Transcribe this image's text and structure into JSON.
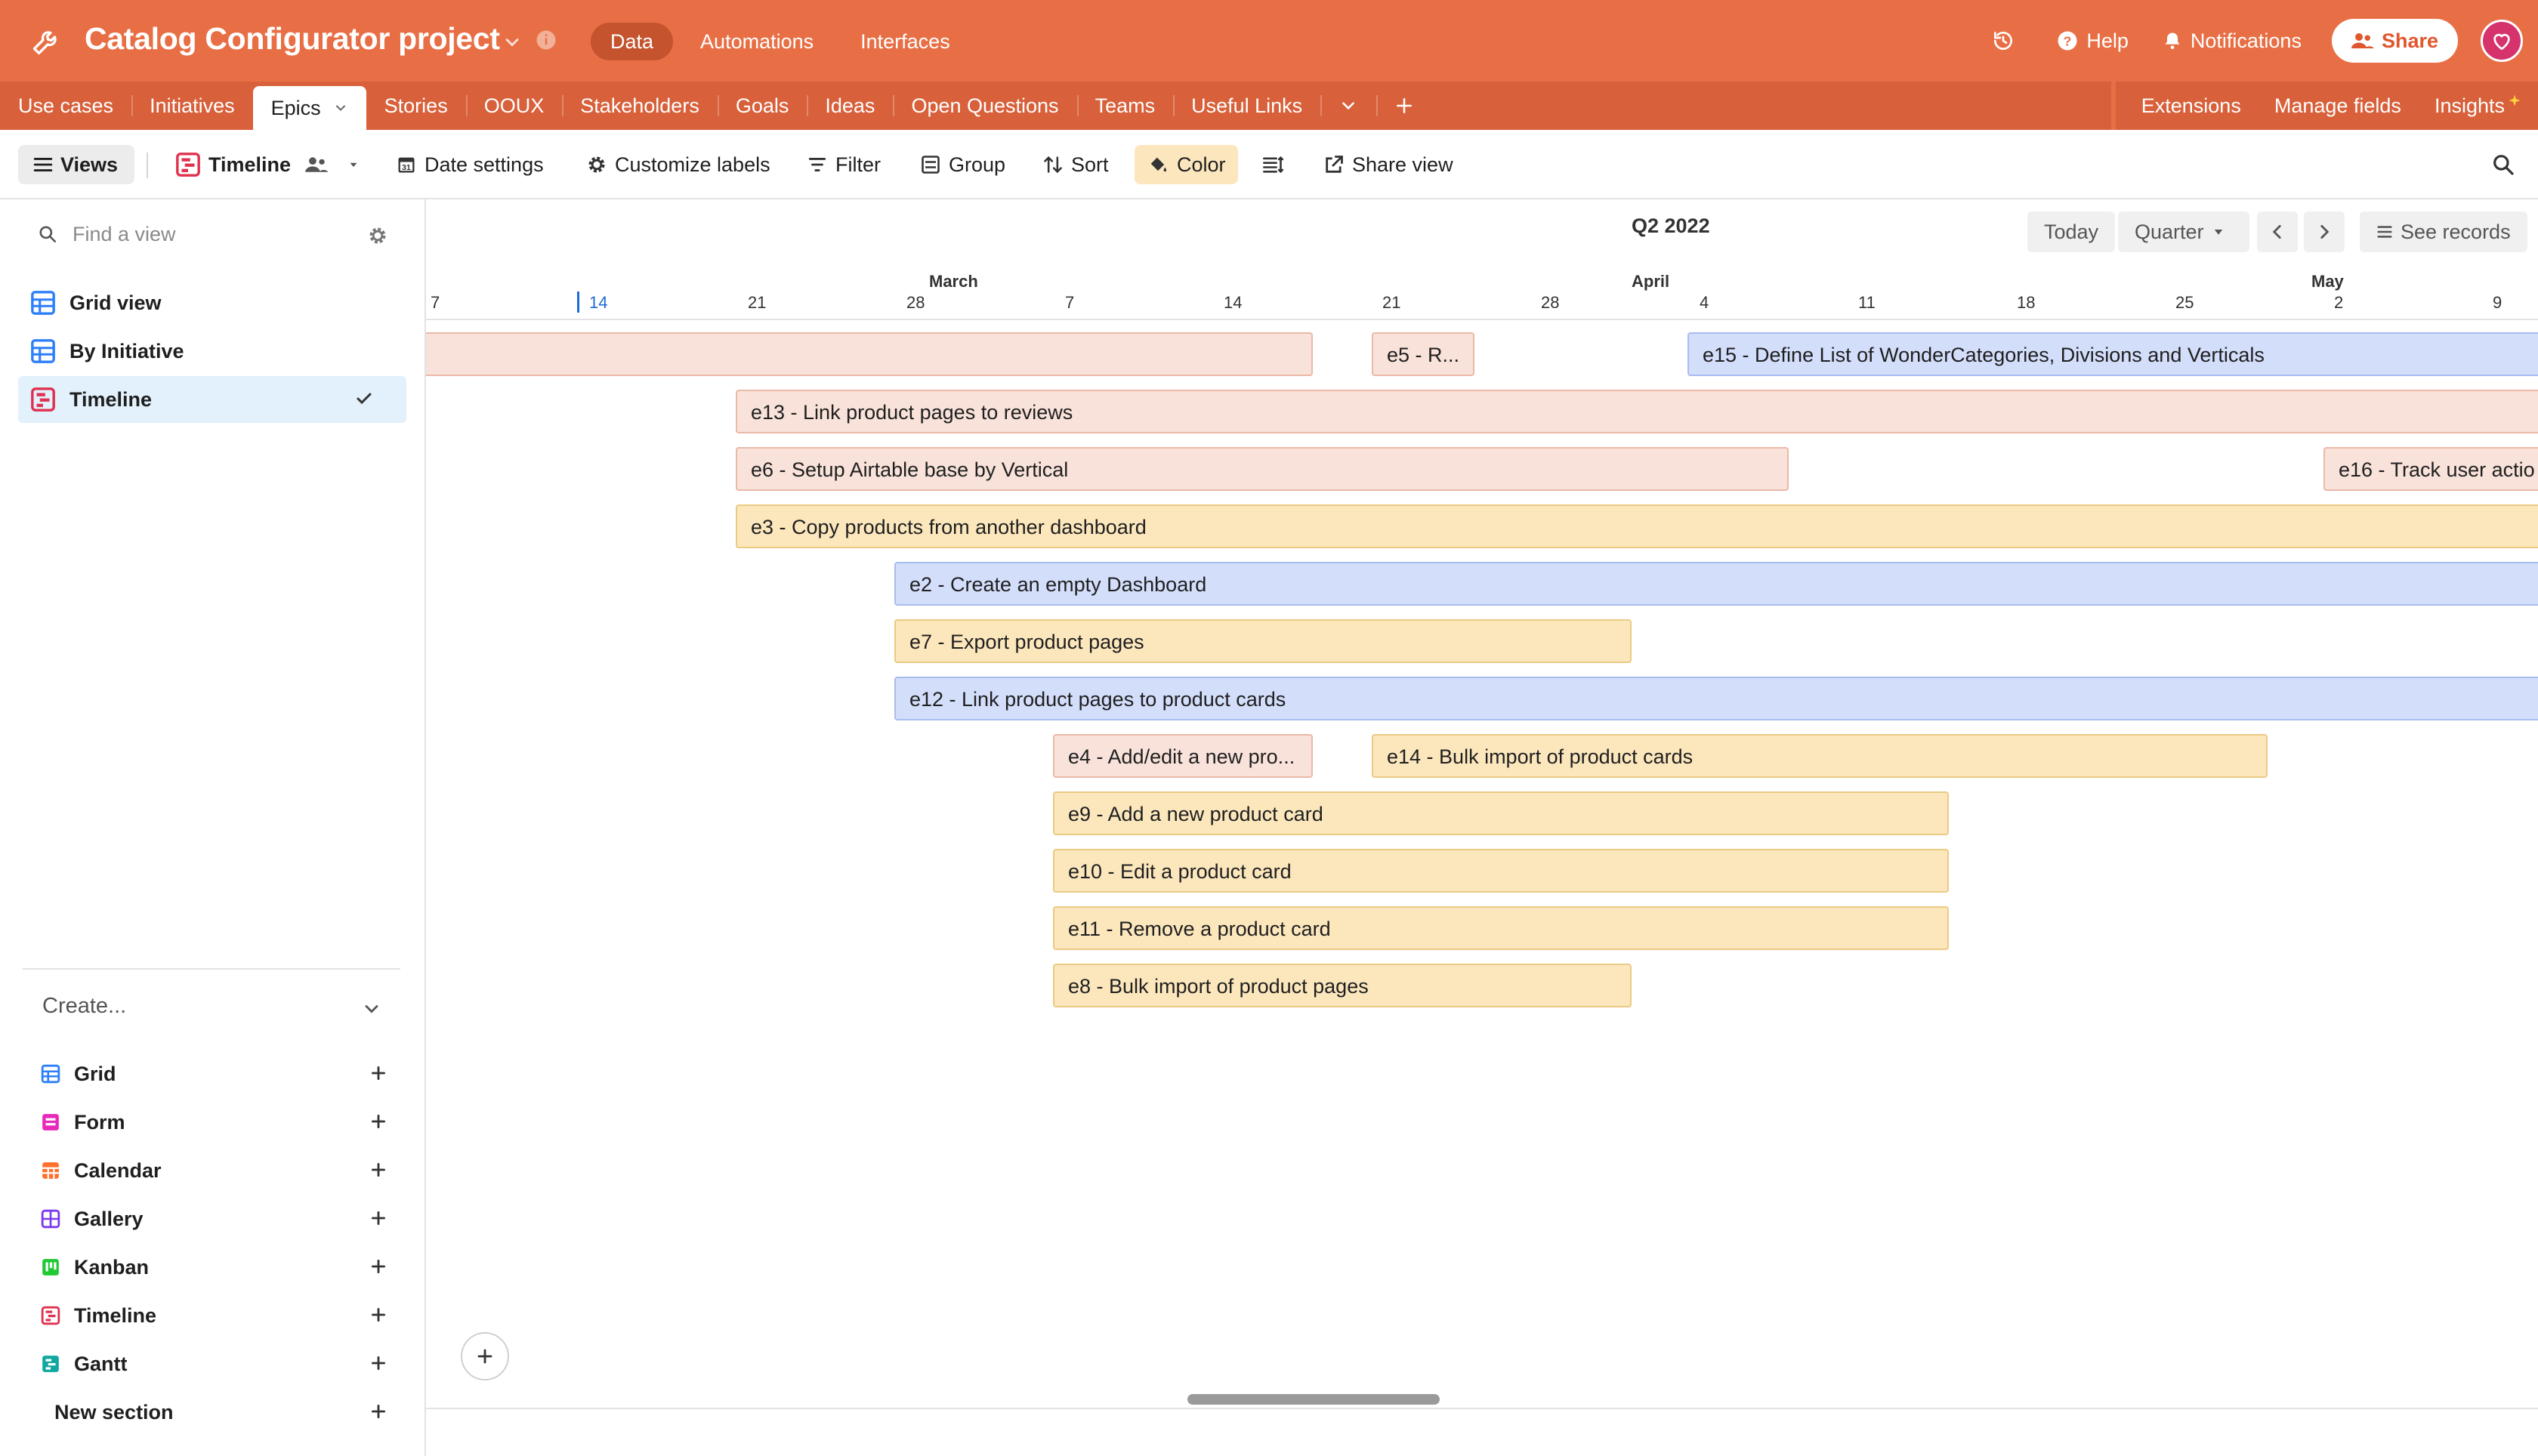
{
  "app": {
    "title": "Catalog Configurator project",
    "nav": [
      "Data",
      "Automations",
      "Interfaces"
    ],
    "help": "Help",
    "notifications": "Notifications",
    "share": "Share",
    "accent": "#e86f45"
  },
  "tables": {
    "tabs": [
      "Use cases",
      "Initiatives",
      "Epics",
      "Stories",
      "OOUX",
      "Stakeholders",
      "Goals",
      "Ideas",
      "Open Questions",
      "Teams",
      "Useful Links"
    ],
    "active": "Epics",
    "right": [
      "Extensions",
      "Manage fields",
      "Insights"
    ]
  },
  "toolbar": {
    "views": "Views",
    "view_name": "Timeline",
    "date_settings": "Date settings",
    "customize_labels": "Customize labels",
    "filter": "Filter",
    "group": "Group",
    "sort": "Sort",
    "color": "Color",
    "share_view": "Share view"
  },
  "sidebar": {
    "find_placeholder": "Find a view",
    "views": [
      {
        "label": "Grid view",
        "icon": "grid-icon"
      },
      {
        "label": "By Initiative",
        "icon": "grid-icon"
      },
      {
        "label": "Timeline",
        "icon": "timeline-icon",
        "active": true
      }
    ],
    "create_label": "Create...",
    "create_items": [
      {
        "label": "Grid",
        "icon": "grid-icon",
        "color": "#2d7ff9"
      },
      {
        "label": "Form",
        "icon": "form-icon",
        "color": "#e929ba"
      },
      {
        "label": "Calendar",
        "icon": "calendar-icon",
        "color": "#ff6f2c"
      },
      {
        "label": "Gallery",
        "icon": "gallery-icon",
        "color": "#7c39ed"
      },
      {
        "label": "Kanban",
        "icon": "kanban-icon",
        "color": "#20c933"
      },
      {
        "label": "Timeline",
        "icon": "timeline-icon",
        "color": "#f82b60"
      },
      {
        "label": "Gantt",
        "icon": "gantt-icon",
        "color": "#18bfff"
      }
    ],
    "new_section": "New section"
  },
  "timeline": {
    "period": "Q2 2022",
    "today": "Today",
    "scale": "Quarter",
    "see_records": "See records",
    "months": [
      "March",
      "April",
      "May"
    ],
    "days": [
      "7",
      "14",
      "21",
      "28",
      "7",
      "14",
      "21",
      "28",
      "4",
      "11",
      "18",
      "25",
      "2",
      "9"
    ],
    "today_day": "14",
    "bars": [
      {
        "label": "e5 - R...",
        "color": "pink"
      },
      {
        "label": "e15 - Define List of WonderCategories, Divisions and Verticals",
        "color": "blue"
      },
      {
        "label": "e13 - Link product pages to reviews",
        "color": "pink"
      },
      {
        "label": "e6 - Setup Airtable base by Vertical",
        "color": "pink"
      },
      {
        "label": "e16 - Track user actio",
        "color": "pink"
      },
      {
        "label": "e3 - Copy products from another dashboard",
        "color": "yellow"
      },
      {
        "label": "e2 - Create an empty Dashboard",
        "color": "blue"
      },
      {
        "label": "e7 - Export product pages",
        "color": "yellow"
      },
      {
        "label": "e12 - Link product pages to product cards",
        "color": "blue"
      },
      {
        "label": "e4 - Add/edit a new pro...",
        "color": "pink"
      },
      {
        "label": "e14 - Bulk import of product cards",
        "color": "yellow"
      },
      {
        "label": "e9 - Add a new product card",
        "color": "yellow"
      },
      {
        "label": "e10 - Edit a product card",
        "color": "yellow"
      },
      {
        "label": "e11 - Remove a product card",
        "color": "yellow"
      },
      {
        "label": "e8 - Bulk import of product pages",
        "color": "yellow"
      }
    ]
  }
}
